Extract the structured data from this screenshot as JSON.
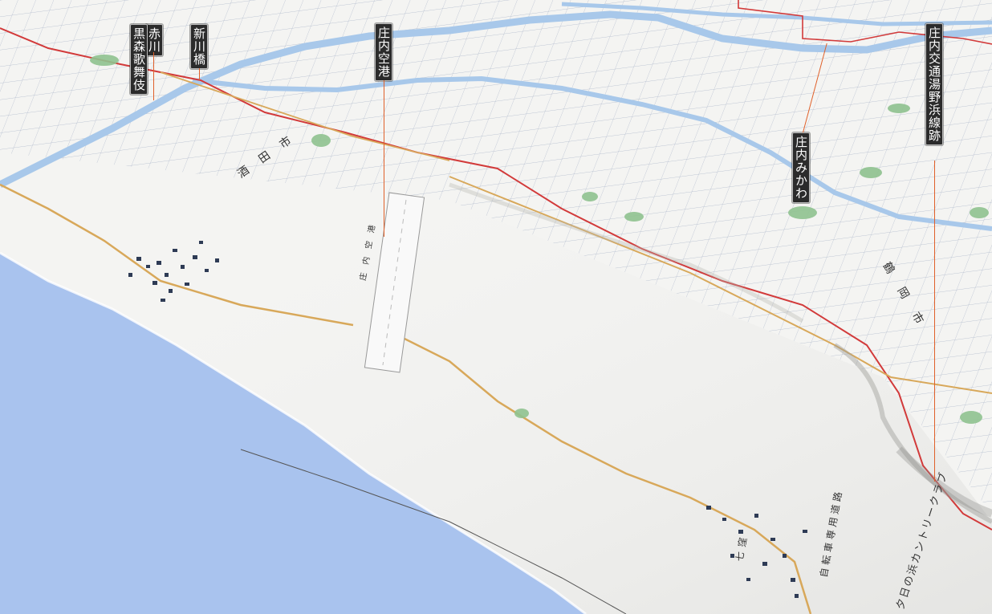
{
  "map": {
    "colors": {
      "sea": "#a9c3ee",
      "land": "#f4f4f2",
      "river": "#a8c8ea",
      "road": "#d8a85a",
      "boundary": "#d23a3a",
      "leader": "#e0602a",
      "label_bg": "#2b2b2b",
      "label_text": "#ffffff"
    }
  },
  "labels": [
    {
      "id": "akagawa",
      "text": "赤川"
    },
    {
      "id": "kurokawa",
      "text": "黒森歌舞伎"
    },
    {
      "id": "shinkawa-bridge",
      "text": "新川橋"
    },
    {
      "id": "shonai-airport",
      "text": "庄内空港"
    },
    {
      "id": "shonai-mikawa",
      "text": "庄内みかわ"
    },
    {
      "id": "yunohama-line",
      "text": "庄内交通湯野浜線跡"
    }
  ],
  "map_text": {
    "sakata_city": "酒田市",
    "tsuruoka_city": "鶴岡市",
    "airport_runway": "庄内空港",
    "cycling_road": "自転車専用道路",
    "country_club": "夕日の浜カントリークラブ",
    "shichikubo": "七窪"
  }
}
